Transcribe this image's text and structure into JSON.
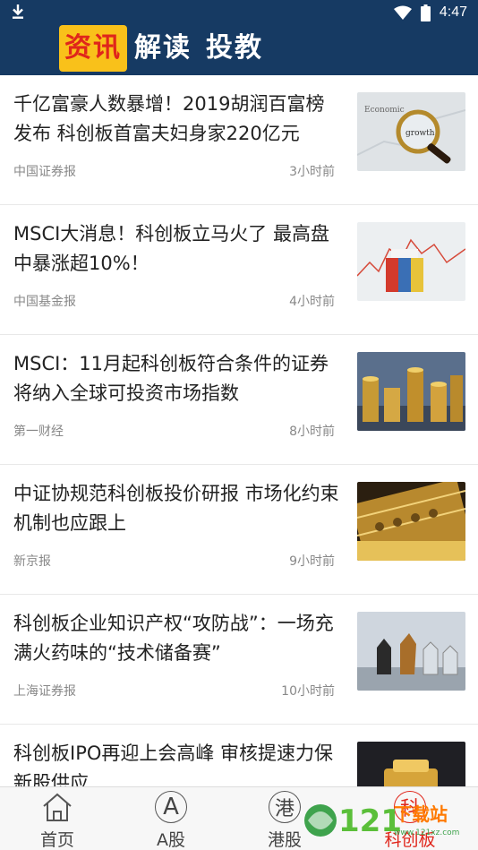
{
  "status_bar": {
    "time": "4:47"
  },
  "header": {
    "tabs": [
      {
        "label": "资讯",
        "active": true
      },
      {
        "label": "解读",
        "active": false
      },
      {
        "label": "投教",
        "active": false
      }
    ]
  },
  "articles": [
    {
      "title": "千亿富豪人数暴增！2019胡润百富榜发布 科创板首富夫妇身家220亿元",
      "source": "中国证券报",
      "time": "3小时前",
      "thumb_icon": "magnifier-economic-growth-image"
    },
    {
      "title": "MSCI大消息！科创板立马火了 最高盘中暴涨超10%！",
      "source": "中国基金报",
      "time": "4小时前",
      "thumb_icon": "stock-chart-blocks-image"
    },
    {
      "title": "MSCI：11月起科创板符合条件的证券将纳入全球可投资市场指数",
      "source": "第一财经",
      "time": "8小时前",
      "thumb_icon": "gold-coin-stacks-image"
    },
    {
      "title": "中证协规范科创板投价研报 市场化约束机制也应跟上",
      "source": "新京报",
      "time": "9小时前",
      "thumb_icon": "golden-abacus-image"
    },
    {
      "title": "科创板企业知识产权“攻防战”：一场充满火药味的“技术储备赛”",
      "source": "上海证券报",
      "time": "10小时前",
      "thumb_icon": "chess-pieces-image"
    },
    {
      "title": "科创板IPO再迎上会高峰 审核提速力保新股供应",
      "source": "",
      "time": "",
      "thumb_icon": "gold-bars-hands-image"
    }
  ],
  "bottom_nav": [
    {
      "label": "首页",
      "icon": "home-icon",
      "glyph": "",
      "active": false
    },
    {
      "label": "A股",
      "icon": "a-share-icon",
      "glyph": "A",
      "active": false
    },
    {
      "label": "港股",
      "icon": "hk-share-icon",
      "glyph": "港",
      "active": false
    },
    {
      "label": "科创板",
      "icon": "star-market-icon",
      "glyph": "科",
      "active": true
    }
  ],
  "watermark": {
    "text": "121下载站",
    "subtext": "www.121xz.com"
  },
  "colors": {
    "header_bg": "#163a63",
    "active_tab_bg": "#f9c11a",
    "active_red": "#e0261b"
  }
}
